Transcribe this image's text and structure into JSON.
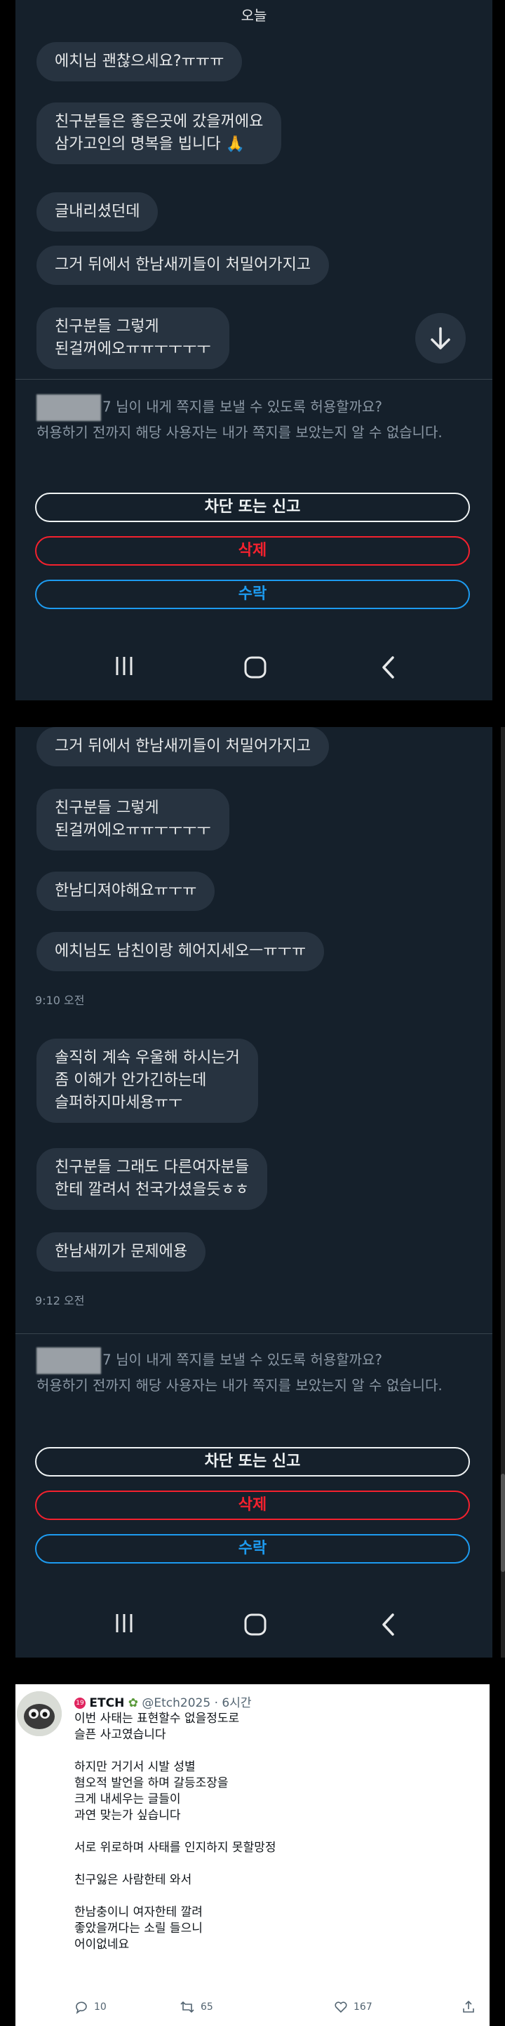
{
  "screenshot1": {
    "date_label": "오늘",
    "messages": [
      "에치님 괜찮으세요?ㅠㅠㅠ",
      "친구분들은 좋은곳에 갔을꺼에요\n삼가고인의 명복을 빕니다 🙏",
      "글내리셨던데",
      "그거 뒤에서 한남새끼들이 처밀어가지고",
      "친구분들 그렇게\n된걸꺼에오ㅠㅠㅜㅜㅜㅜ"
    ],
    "request": {
      "suffix": "7 님이 내게 쪽지를 보낼 수 있도록 허용할까요?",
      "note": "허용하기 전까지 해당 사용자는 내가 쪽지를 보았는지 알 수 없습니다."
    },
    "buttons": {
      "block": "차단 또는 신고",
      "delete": "삭제",
      "accept": "수락"
    }
  },
  "screenshot2": {
    "messages_a": [
      "그거 뒤에서 한남새끼들이 처밀어가지고",
      "친구분들 그렇게\n된걸꺼에오ㅠㅠㅜㅜㅜㅜ",
      "한남디져야해요ㅠㅜㅠ",
      "에치님도 남친이랑 헤어지세오ㅡㅠㅜㅠ"
    ],
    "time_a": "9:10 오전",
    "messages_b": [
      "솔직히 계속 우울해 하시는거\n좀 이해가 안가긴하는데\n슬퍼하지마세용ㅠㅜ",
      "친구분들 그래도 다른여자분들\n한테 깔려서 천국가셨을듯ㅎㅎ",
      "한남새끼가 문제에용"
    ],
    "time_b": "9:12 오전",
    "request": {
      "suffix": "7 님이 내게 쪽지를 보낼 수 있도록 허용할까요?",
      "note": "허용하기 전까지 해당 사용자는 내가 쪽지를 보았는지 알 수 없습니다."
    },
    "buttons": {
      "block": "차단 또는 신고",
      "delete": "삭제",
      "accept": "수락"
    }
  },
  "tweet": {
    "name": "ETCH",
    "handle": "@Etch2025",
    "time": "6시간",
    "paragraphs": [
      "이번 사태는 표현할수 없을정도로\n슬픈 사고였습니다",
      "하지만 거기서 시발 성별\n혐오적 발언을 하며 갈등조장을\n크게 내세우는 글들이\n과연 맞는가 싶습니다",
      "서로 위로하며 사태를 인지하지 못할망정",
      "친구잃은 사람한테 와서",
      "한남충이니 여자한테 깔려\n좋았을꺼다는 소릴 들으니\n어이없네요"
    ],
    "replies": "10",
    "retweets": "65",
    "likes": "167"
  },
  "icons": [
    "arrow-down-icon",
    "recents-icon",
    "home-icon",
    "back-icon",
    "reply-icon",
    "retweet-icon",
    "like-icon",
    "share-icon"
  ]
}
